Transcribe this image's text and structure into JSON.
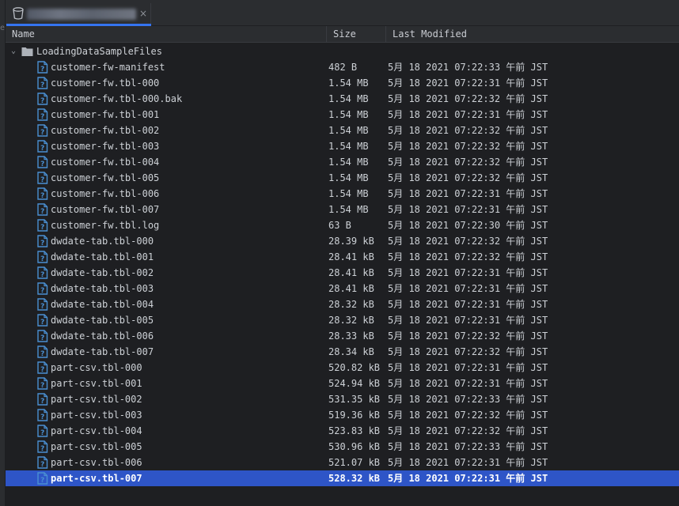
{
  "left_strip": {
    "mark": "e"
  },
  "tab": {
    "close_glyph": "×",
    "icon": "bucket-icon"
  },
  "columns": {
    "name": "Name",
    "size": "Size",
    "modified": "Last Modified"
  },
  "colors": {
    "accent": "#3574f0",
    "selection": "#2e55c7",
    "file_icon": "#4a8fd1"
  },
  "folder": {
    "name": "LoadingDataSampleFiles",
    "expanded": true,
    "icon": "folder-icon"
  },
  "files": [
    {
      "name": "customer-fw-manifest",
      "size": "482 B",
      "modified": "5月 18 2021 07:22:33 午前 JST"
    },
    {
      "name": "customer-fw.tbl-000",
      "size": "1.54 MB",
      "modified": "5月 18 2021 07:22:31 午前 JST"
    },
    {
      "name": "customer-fw.tbl-000.bak",
      "size": "1.54 MB",
      "modified": "5月 18 2021 07:22:32 午前 JST"
    },
    {
      "name": "customer-fw.tbl-001",
      "size": "1.54 MB",
      "modified": "5月 18 2021 07:22:31 午前 JST"
    },
    {
      "name": "customer-fw.tbl-002",
      "size": "1.54 MB",
      "modified": "5月 18 2021 07:22:32 午前 JST"
    },
    {
      "name": "customer-fw.tbl-003",
      "size": "1.54 MB",
      "modified": "5月 18 2021 07:22:32 午前 JST"
    },
    {
      "name": "customer-fw.tbl-004",
      "size": "1.54 MB",
      "modified": "5月 18 2021 07:22:32 午前 JST"
    },
    {
      "name": "customer-fw.tbl-005",
      "size": "1.54 MB",
      "modified": "5月 18 2021 07:22:32 午前 JST"
    },
    {
      "name": "customer-fw.tbl-006",
      "size": "1.54 MB",
      "modified": "5月 18 2021 07:22:31 午前 JST"
    },
    {
      "name": "customer-fw.tbl-007",
      "size": "1.54 MB",
      "modified": "5月 18 2021 07:22:31 午前 JST"
    },
    {
      "name": "customer-fw.tbl.log",
      "size": "63 B",
      "modified": "5月 18 2021 07:22:30 午前 JST"
    },
    {
      "name": "dwdate-tab.tbl-000",
      "size": "28.39 kB",
      "modified": "5月 18 2021 07:22:32 午前 JST"
    },
    {
      "name": "dwdate-tab.tbl-001",
      "size": "28.41 kB",
      "modified": "5月 18 2021 07:22:32 午前 JST"
    },
    {
      "name": "dwdate-tab.tbl-002",
      "size": "28.41 kB",
      "modified": "5月 18 2021 07:22:31 午前 JST"
    },
    {
      "name": "dwdate-tab.tbl-003",
      "size": "28.41 kB",
      "modified": "5月 18 2021 07:22:31 午前 JST"
    },
    {
      "name": "dwdate-tab.tbl-004",
      "size": "28.32 kB",
      "modified": "5月 18 2021 07:22:31 午前 JST"
    },
    {
      "name": "dwdate-tab.tbl-005",
      "size": "28.32 kB",
      "modified": "5月 18 2021 07:22:31 午前 JST"
    },
    {
      "name": "dwdate-tab.tbl-006",
      "size": "28.33 kB",
      "modified": "5月 18 2021 07:22:32 午前 JST"
    },
    {
      "name": "dwdate-tab.tbl-007",
      "size": "28.34 kB",
      "modified": "5月 18 2021 07:22:32 午前 JST"
    },
    {
      "name": "part-csv.tbl-000",
      "size": "520.82 kB",
      "modified": "5月 18 2021 07:22:31 午前 JST"
    },
    {
      "name": "part-csv.tbl-001",
      "size": "524.94 kB",
      "modified": "5月 18 2021 07:22:31 午前 JST"
    },
    {
      "name": "part-csv.tbl-002",
      "size": "531.35 kB",
      "modified": "5月 18 2021 07:22:33 午前 JST"
    },
    {
      "name": "part-csv.tbl-003",
      "size": "519.36 kB",
      "modified": "5月 18 2021 07:22:32 午前 JST"
    },
    {
      "name": "part-csv.tbl-004",
      "size": "523.83 kB",
      "modified": "5月 18 2021 07:22:32 午前 JST"
    },
    {
      "name": "part-csv.tbl-005",
      "size": "530.96 kB",
      "modified": "5月 18 2021 07:22:33 午前 JST"
    },
    {
      "name": "part-csv.tbl-006",
      "size": "521.07 kB",
      "modified": "5月 18 2021 07:22:31 午前 JST"
    },
    {
      "name": "part-csv.tbl-007",
      "size": "528.32 kB",
      "modified": "5月 18 2021 07:22:31 午前 JST",
      "selected": true
    }
  ]
}
